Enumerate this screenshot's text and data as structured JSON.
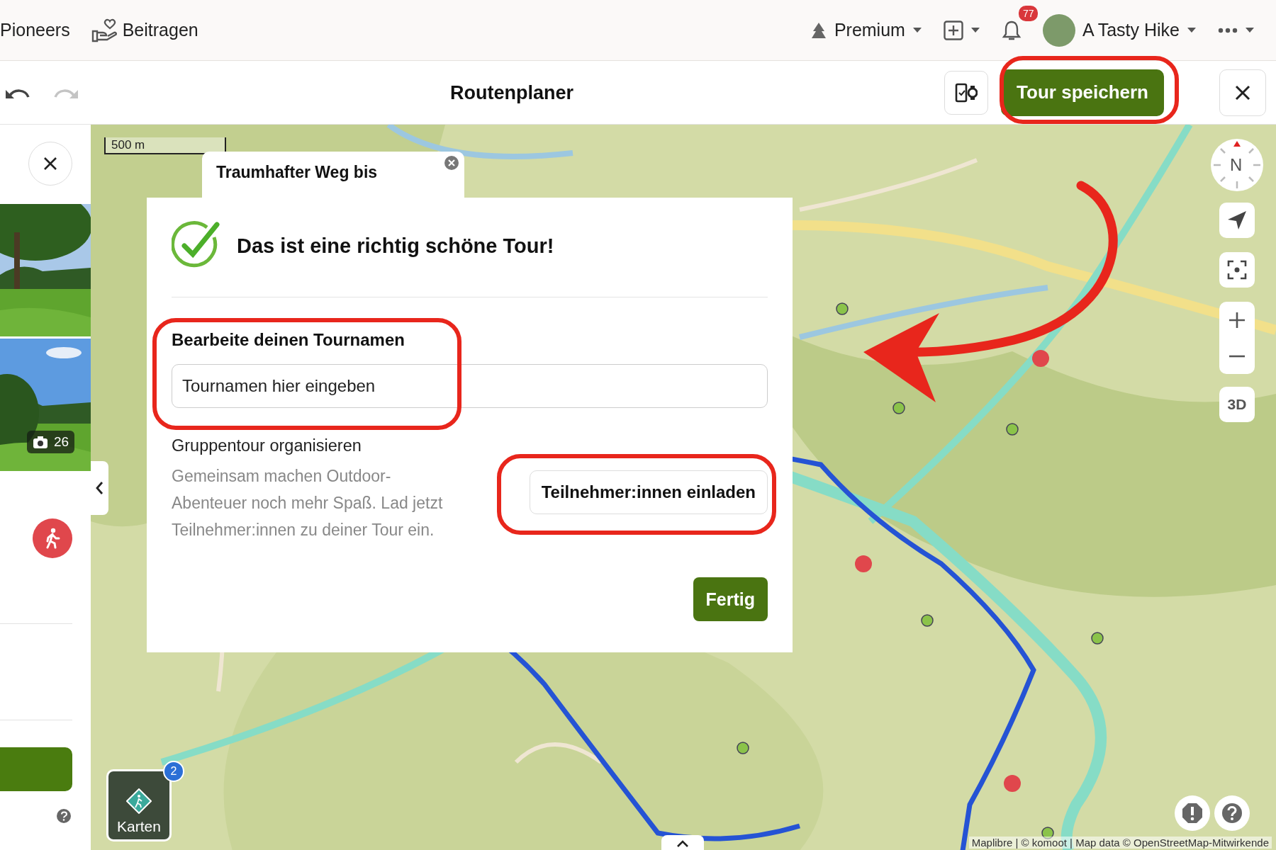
{
  "top_nav": {
    "links": [
      {
        "kind": "plain",
        "label": "Pioneers"
      },
      {
        "kind": "contribute",
        "label": "Beitragen"
      }
    ],
    "premium": "Premium",
    "notifications": "77",
    "user": "A Tasty Hike"
  },
  "toolbar": {
    "history": [
      {
        "kind": "undo",
        "disabled": false
      },
      {
        "kind": "redo",
        "disabled": true
      }
    ],
    "title": "Routenplaner",
    "save": "Tour speichern"
  },
  "sidebar": {
    "photo_count": "26"
  },
  "map": {
    "scale": "500 m",
    "popup_title": "Traumhafter Weg bis",
    "compass": "N",
    "three_d": "3D",
    "layers_label": "Karten",
    "layers_badge": "2",
    "attribution": "Maplibre | © komoot | Map data © OpenStreetMap-Mitwirkende"
  },
  "dialog": {
    "heading": "Das ist eine richtig schöne Tour!",
    "name_label": "Bearbeite deinen Tournamen",
    "name_placeholder": "Tournamen hier eingeben",
    "group_title": "Gruppentour organisieren",
    "group_text": "Gemeinsam machen Outdoor-Abenteuer noch mehr Spaß. Lad jetzt Teilnehmer:innen zu deiner Tour ein.",
    "invite": "Teilnehmer:innen einladen",
    "done": "Fertig"
  }
}
